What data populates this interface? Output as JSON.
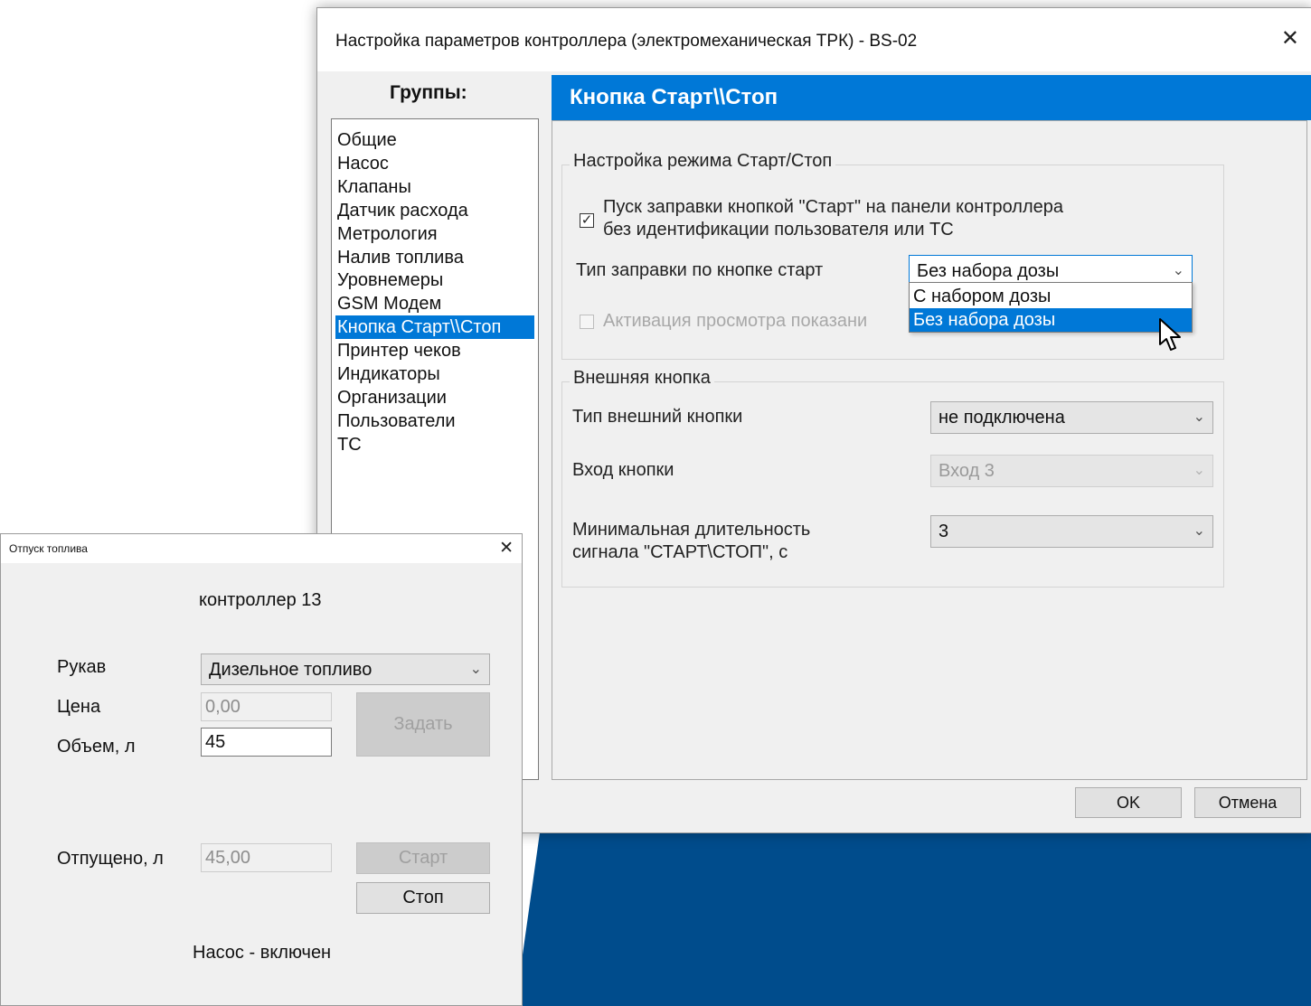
{
  "main_dialog": {
    "title": "Настройка параметров контроллера (электромеханическая ТРК) - BS-02",
    "close_glyph": "✕",
    "groups_header": "Группы:",
    "groups": [
      "Общие",
      "Насос",
      "Клапаны",
      "Датчик расхода",
      "Метрология",
      "Налив топлива",
      "Уровнемеры",
      "GSM Модем",
      "Кнопка Старт\\\\Стоп",
      "Принтер чеков",
      "Индикаторы",
      "Организации",
      "Пользователи",
      "ТС"
    ],
    "selected_group_index": 8,
    "section_title": "Кнопка Старт\\\\Стоп",
    "start_stop_group": {
      "legend": "Настройка режима Старт/Стоп",
      "checkbox_line1": "Пуск заправки кнопкой \"Старт\" на панели контроллера",
      "checkbox_line2": "без идентификации пользователя или ТС",
      "checkbox_checked": true,
      "fuel_type_label": "Тип заправки по кнопке старт",
      "fuel_type_value": "Без набора дозы",
      "fuel_type_options": [
        "С набором дозы",
        "Без набора дозы"
      ],
      "highlighted_option_index": 1,
      "activation_label": "Активация просмотра показани"
    },
    "external_group": {
      "legend": "Внешняя кнопка",
      "type_label": "Тип внешний кнопки",
      "type_value": "не подключена",
      "input_label": "Вход кнопки",
      "input_value": "Вход 3",
      "min_duration_label_line1": "Минимальная длительность",
      "min_duration_label_line2": "сигнала \"СТАРТ\\СТОП\", с",
      "min_duration_value": "3"
    },
    "ok_label": "OK",
    "cancel_label": "Отмена"
  },
  "fuel_dialog": {
    "title": "Отпуск топлива",
    "close_glyph": "✕",
    "controller": "контроллер 13",
    "hose_label": "Рукав",
    "hose_value": "Дизельное топливо",
    "price_label": "Цена",
    "price_value": "0,00",
    "volume_label": "Объем, л",
    "volume_value": "45",
    "set_button": "Задать",
    "dispensed_label": "Отпущено, л",
    "dispensed_value": "45,00",
    "start_button": "Старт",
    "stop_button": "Стоп",
    "pump_status": "Насос - включен"
  },
  "icons": {
    "chevron": "chevron-down-icon",
    "check": "check-icon",
    "close": "close-icon",
    "cursor": "mouse-cursor-icon"
  },
  "colors": {
    "accent": "#0078d7",
    "background_blue": "#004c8c"
  }
}
